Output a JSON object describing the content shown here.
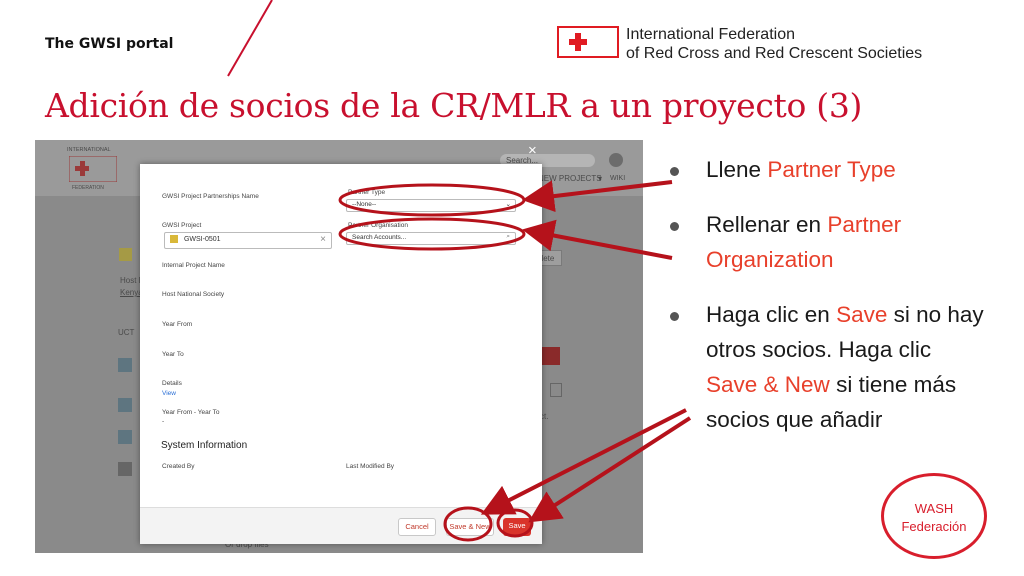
{
  "slide": {
    "portal_label": "The GWSI portal",
    "title": "Adición de socios de la CR/MLR a un proyecto (3)",
    "ifrc_name_line1": "International Federation",
    "ifrc_name_line2": "of Red Cross and Red Crescent Societies",
    "wash_line1": "WASH",
    "wash_line2": "Federación"
  },
  "background_app": {
    "logo_top": "INTERNATIONAL",
    "logo_bottom": "FEDERATION",
    "search_placeholder": "Search...",
    "nav_new_projects": "NEW PROJECTS",
    "nav_wiki": "WIKI",
    "host_label": "Host N",
    "host_value": "Kenya",
    "section_label": "UCT",
    "delete_label": "elete",
    "object_label": "ct.",
    "drop_files": "Or drop files"
  },
  "modal": {
    "close_symbol": "×",
    "fields": {
      "partnership_name": "GWSI Project Partnerships Name",
      "partner_type": "Partner Type",
      "partner_type_value": "--None--",
      "gwsi_project": "GWSI Project",
      "gwsi_project_value": "GWSI-0501",
      "partner_org": "Partner Organisation",
      "partner_org_placeholder": "Search Accounts...",
      "internal_name": "Internal Project Name",
      "host_ns": "Host National Society",
      "year_from": "Year From",
      "year_to": "Year To",
      "details": "Details",
      "details_link": "View",
      "year_range": "Year From - Year To",
      "year_range_value": "-"
    },
    "system_info_title": "System Information",
    "created_by": "Created By",
    "last_modified_by": "Last Modified By",
    "buttons": {
      "cancel": "Cancel",
      "save_new": "Save & New",
      "save": "Save"
    }
  },
  "bullets": {
    "b1_prefix": "Llene ",
    "b1_highlight": "Partner Type",
    "b2_prefix": "Rellenar en ",
    "b2_highlight": "Partner Organization",
    "b3_prefix": "Haga clic en ",
    "b3_highlight1": "Save",
    "b3_mid": " si no hay otros socios. Haga clic ",
    "b3_highlight2": "Save & New",
    "b3_suffix": " si tiene más socios que añadir"
  },
  "colors": {
    "accent_red": "#c8102e",
    "highlight_red": "#e8402b",
    "annotation_red": "#b5121b"
  }
}
